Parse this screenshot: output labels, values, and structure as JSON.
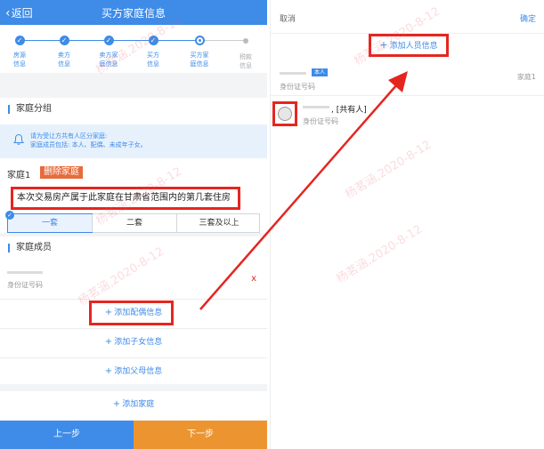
{
  "left": {
    "header": {
      "back_label": "返回",
      "title": "买方家庭信息"
    },
    "steps": [
      {
        "label_line1": "房源",
        "label_line2": "信息",
        "state": "done"
      },
      {
        "label_line1": "卖方",
        "label_line2": "信息",
        "state": "done"
      },
      {
        "label_line1": "卖方家",
        "label_line2": "庭信息",
        "state": "done"
      },
      {
        "label_line1": "买方",
        "label_line2": "信息",
        "state": "done"
      },
      {
        "label_line1": "买方家",
        "label_line2": "庭信息",
        "state": "current"
      },
      {
        "label_line1": "税款",
        "label_line2": "信息",
        "state": "todo"
      }
    ],
    "section_family_group": "家庭分组",
    "notice": {
      "line1": "请为受让方共有人区分家庭:",
      "line2": "家庭成员包括: 本人、配偶、未成年子女。"
    },
    "family_label": "家庭1",
    "delete_family": "删除家庭",
    "question": "本次交易房产属于此家庭在甘肃省范围内的第几套住房",
    "options": [
      "一套",
      "二套",
      "三套及以上"
    ],
    "selected_option": "一套",
    "section_members": "家庭成员",
    "member": {
      "id_label": "身份证号码",
      "remove": "x"
    },
    "add_spouse": "添加配偶信息",
    "add_child": "添加子女信息",
    "add_parent": "添加父母信息",
    "add_family": "添加家庭",
    "prev_button": "上一步",
    "next_button": "下一步"
  },
  "right": {
    "cancel": "取消",
    "confirm": "确定",
    "add_person": "添加人员信息",
    "item1": {
      "tag": "本人",
      "id_label": "身份证号码",
      "family": "家庭1"
    },
    "item2": {
      "name": ", [共有人]",
      "id_label": "身份证号码"
    }
  },
  "watermark": "杨茗涵,2020-8-12",
  "colors": {
    "primary": "#3e8be8",
    "accent_orange": "#ec9530",
    "delete_red": "#e76b3b",
    "annotation_red": "#e52620"
  }
}
